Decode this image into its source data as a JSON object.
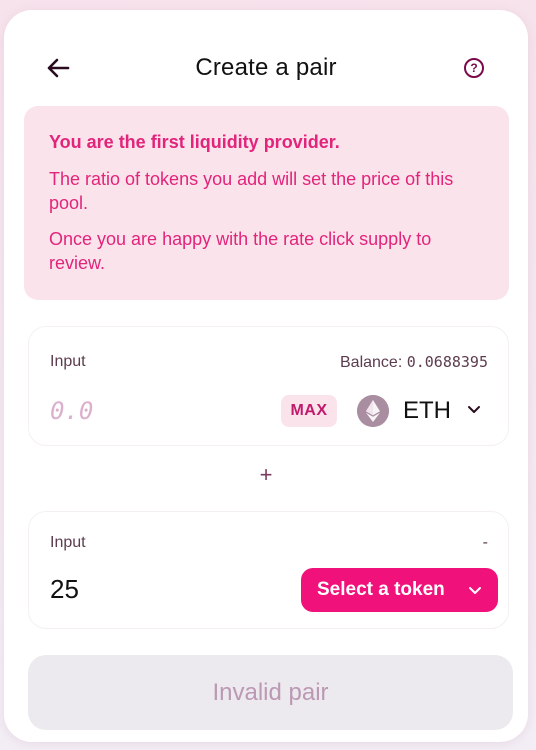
{
  "header": {
    "title": "Create a pair"
  },
  "notice": {
    "title": "You are the first liquidity provider.",
    "line1": "The ratio of tokens you add will set the price of this pool.",
    "line2": "Once you are happy with the rate click supply to review."
  },
  "input_a": {
    "label": "Input",
    "balance_label": "Balance:",
    "balance_value": "0.0688395",
    "placeholder": "0.0",
    "max_label": "MAX",
    "token_symbol": "ETH",
    "token_icon": "ethereum-icon"
  },
  "plus_symbol": "+",
  "input_b": {
    "label": "Input",
    "balance": "-",
    "value": "25",
    "select_label": "Select a token"
  },
  "submit": {
    "label": "Invalid pair"
  },
  "colors": {
    "accent": "#f0117a",
    "notice_bg": "#fbe3ec",
    "notice_text": "#e2247b",
    "disabled_bg": "#edeaef",
    "disabled_text": "#bb98b3"
  }
}
